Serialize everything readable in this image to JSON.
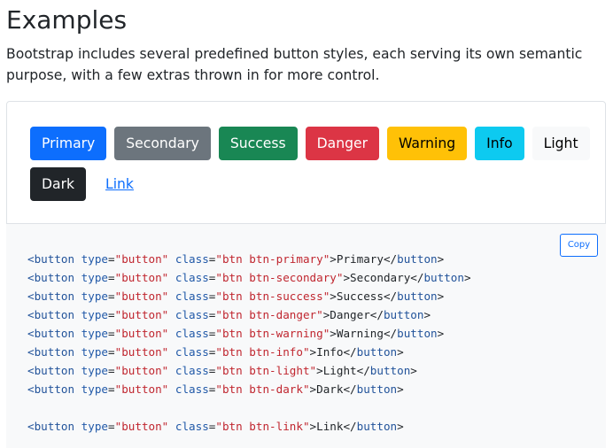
{
  "heading": "Examples",
  "lead": "Bootstrap includes several predefined button styles, each serving its own semantic purpose, with a few extras thrown in for more control.",
  "buttons": [
    {
      "label": "Primary",
      "variant": "primary"
    },
    {
      "label": "Secondary",
      "variant": "secondary"
    },
    {
      "label": "Success",
      "variant": "success"
    },
    {
      "label": "Danger",
      "variant": "danger"
    },
    {
      "label": "Warning",
      "variant": "warning"
    },
    {
      "label": "Info",
      "variant": "info"
    },
    {
      "label": "Light",
      "variant": "light"
    },
    {
      "label": "Dark",
      "variant": "dark"
    },
    {
      "label": "Link",
      "variant": "link"
    }
  ],
  "colors": {
    "primary": "#0d6efd",
    "secondary": "#6c757d",
    "success": "#198754",
    "danger": "#dc3545",
    "warning": "#ffc107",
    "info": "#0dcaf0",
    "light": "#f8f9fa",
    "dark": "#212529"
  },
  "copy_label": "Copy",
  "code_lines": [
    {
      "open": "<",
      "tag": "button",
      "attr1": "type",
      "val1": "\"button\"",
      "attr2": "class",
      "val2": "\"btn btn-primary\"",
      "text": "Primary",
      "close_tag": "button"
    },
    {
      "open": "<",
      "tag": "button",
      "attr1": "type",
      "val1": "\"button\"",
      "attr2": "class",
      "val2": "\"btn btn-secondary\"",
      "text": "Secondary",
      "close_tag": "button"
    },
    {
      "open": "<",
      "tag": "button",
      "attr1": "type",
      "val1": "\"button\"",
      "attr2": "class",
      "val2": "\"btn btn-success\"",
      "text": "Success",
      "close_tag": "button"
    },
    {
      "open": "<",
      "tag": "button",
      "attr1": "type",
      "val1": "\"button\"",
      "attr2": "class",
      "val2": "\"btn btn-danger\"",
      "text": "Danger",
      "close_tag": "button"
    },
    {
      "open": "<",
      "tag": "button",
      "attr1": "type",
      "val1": "\"button\"",
      "attr2": "class",
      "val2": "\"btn btn-warning\"",
      "text": "Warning",
      "close_tag": "button"
    },
    {
      "open": "<",
      "tag": "button",
      "attr1": "type",
      "val1": "\"button\"",
      "attr2": "class",
      "val2": "\"btn btn-info\"",
      "text": "Info",
      "close_tag": "button"
    },
    {
      "open": "<",
      "tag": "button",
      "attr1": "type",
      "val1": "\"button\"",
      "attr2": "class",
      "val2": "\"btn btn-light\"",
      "text": "Light",
      "close_tag": "button"
    },
    {
      "open": "<",
      "tag": "button",
      "attr1": "type",
      "val1": "\"button\"",
      "attr2": "class",
      "val2": "\"btn btn-dark\"",
      "text": "Dark",
      "close_tag": "button"
    },
    {
      "blank": true
    },
    {
      "open": "<",
      "tag": "button",
      "attr1": "type",
      "val1": "\"button\"",
      "attr2": "class",
      "val2": "\"btn btn-link\"",
      "text": "Link",
      "close_tag": "button"
    }
  ]
}
